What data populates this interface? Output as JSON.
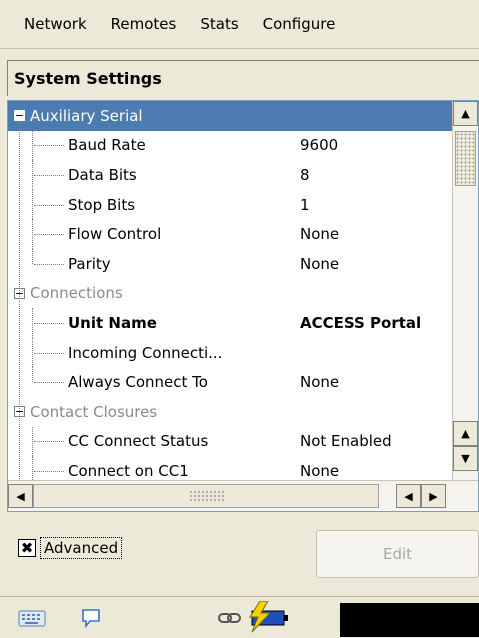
{
  "menu": {
    "items": [
      "Network",
      "Remotes",
      "Stats",
      "Configure"
    ]
  },
  "panel": {
    "title": "System Settings"
  },
  "tree": {
    "rows": [
      {
        "type": "category",
        "label": "Auxiliary Serial",
        "selected": true,
        "expanded": true
      },
      {
        "type": "leaf",
        "label": "Baud Rate",
        "value": "9600"
      },
      {
        "type": "leaf",
        "label": "Data Bits",
        "value": "8"
      },
      {
        "type": "leaf",
        "label": "Stop Bits",
        "value": "1"
      },
      {
        "type": "leaf",
        "label": "Flow Control",
        "value": "None"
      },
      {
        "type": "leaf",
        "label": "Parity",
        "value": "None",
        "last": true
      },
      {
        "type": "category",
        "label": "Connections",
        "expanded": true
      },
      {
        "type": "leaf",
        "label": "Unit Name",
        "value": "ACCESS Portal",
        "bold": true
      },
      {
        "type": "leaf",
        "label": "Incoming Connecti...",
        "value": ""
      },
      {
        "type": "leaf",
        "label": "Always Connect To",
        "value": "None",
        "last": true
      },
      {
        "type": "category",
        "label": "Contact Closures",
        "expanded": true
      },
      {
        "type": "leaf",
        "label": "CC Connect Status",
        "value": "Not Enabled"
      },
      {
        "type": "leaf",
        "label": "Connect on CC1",
        "value": "None"
      }
    ]
  },
  "advanced": {
    "label": "Advanced",
    "checked": true,
    "mark": "✖"
  },
  "edit_button": {
    "label": "Edit",
    "enabled": false
  },
  "icons": {
    "expander_minus": "−",
    "arrow_up": "▲",
    "arrow_down": "▼",
    "arrow_left": "◀",
    "arrow_right": "▶"
  },
  "colors": {
    "selection": "#4b7bb0",
    "battery": "#1e4fbf",
    "lightning": "#f7d000"
  }
}
